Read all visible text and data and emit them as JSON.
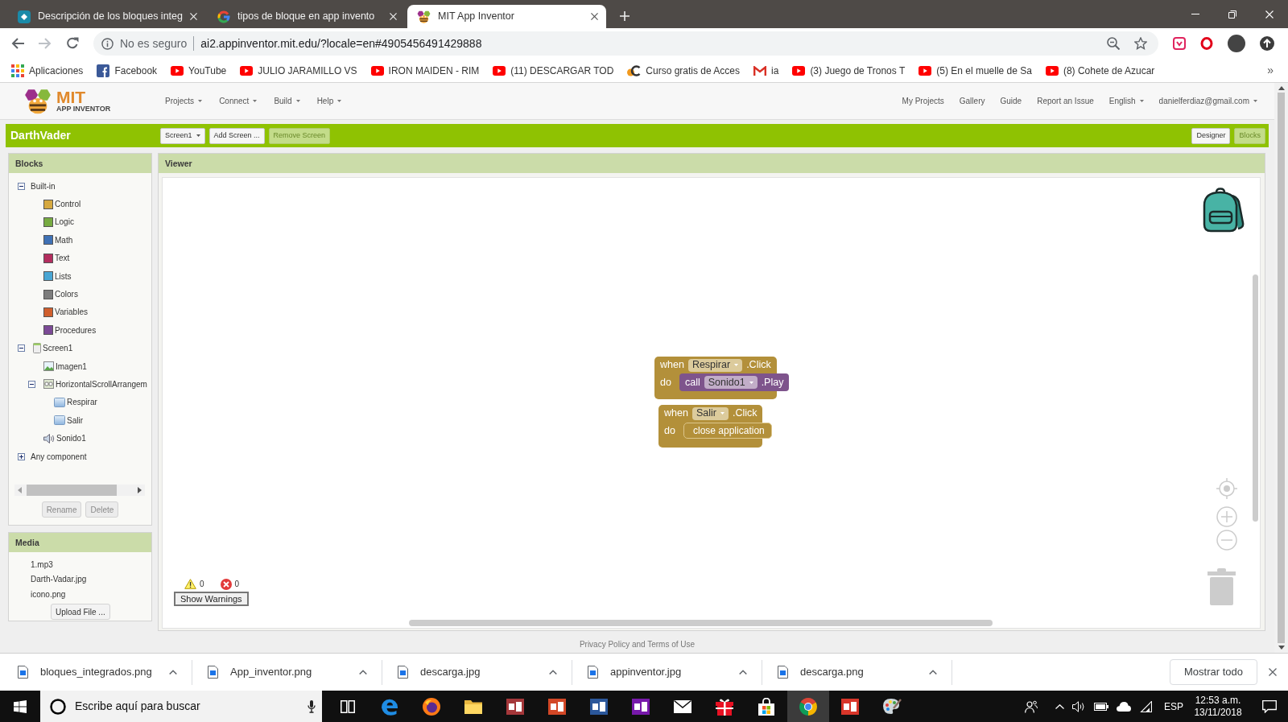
{
  "browser": {
    "tabs": [
      {
        "kind": "docs",
        "title": "Descripción de los bloques integ",
        "selected": false
      },
      {
        "kind": "search",
        "title": "tipos de bloque en app invento",
        "selected": false
      },
      {
        "kind": "app",
        "title": "MIT App Inventor",
        "selected": true
      }
    ],
    "address": {
      "security": "No es seguro",
      "url": "ai2.appinventor.mit.edu/?locale=en#4905456491429888"
    },
    "bookmarks": [
      {
        "kind": "apps",
        "label": "Aplicaciones"
      },
      {
        "kind": "social",
        "label": "Facebook"
      },
      {
        "kind": "video",
        "label": "YouTube"
      },
      {
        "kind": "video",
        "label": "JULIO JARAMILLO VS"
      },
      {
        "kind": "video",
        "label": "IRON MAIDEN - RIM"
      },
      {
        "kind": "video",
        "label": "(11) DESCARGAR TOD"
      },
      {
        "kind": "course",
        "label": "Curso gratis de Acces"
      },
      {
        "kind": "mail",
        "label": "ia"
      },
      {
        "kind": "video",
        "label": "(3) Juego de Tronos T"
      },
      {
        "kind": "video",
        "label": "(5) En el muelle de Sa"
      },
      {
        "kind": "video",
        "label": "(8) Cohete de Azucar"
      }
    ],
    "bookmarks_more": "»"
  },
  "app": {
    "logo": {
      "title": "MIT",
      "subtitle": "APP INVENTOR"
    },
    "menus": [
      {
        "label": "Projects",
        "dropdown": true
      },
      {
        "label": "Connect",
        "dropdown": true
      },
      {
        "label": "Build",
        "dropdown": true
      },
      {
        "label": "Help",
        "dropdown": true
      }
    ],
    "links": [
      {
        "label": "My Projects",
        "dropdown": false
      },
      {
        "label": "Gallery",
        "dropdown": false
      },
      {
        "label": "Guide",
        "dropdown": false
      },
      {
        "label": "Report an Issue",
        "dropdown": false
      },
      {
        "label": "English",
        "dropdown": true
      },
      {
        "label": "danielferdiaz@gmail.com",
        "dropdown": true
      }
    ]
  },
  "project": {
    "name": "DarthVader",
    "screen_menu": "Screen1",
    "buttons": [
      {
        "label": "Add Screen ...",
        "disabled": false
      },
      {
        "label": "Remove Screen",
        "disabled": true
      }
    ],
    "views": [
      {
        "label": "Designer",
        "selected": false
      },
      {
        "label": "Blocks",
        "selected": true
      }
    ]
  },
  "blocks_panel": {
    "title": "Blocks",
    "tree": [
      {
        "kind": "group",
        "label": "Built-in",
        "expanded": true,
        "children": [
          {
            "kind": "category",
            "label": "Control",
            "color": "#d6a940"
          },
          {
            "kind": "category",
            "label": "Logic",
            "color": "#77ab41"
          },
          {
            "kind": "category",
            "label": "Math",
            "color": "#3f71b5"
          },
          {
            "kind": "category",
            "label": "Text",
            "color": "#b32d5e"
          },
          {
            "kind": "category",
            "label": "Lists",
            "color": "#49a6d4"
          },
          {
            "kind": "category",
            "label": "Colors",
            "color": "#7d7d7d"
          },
          {
            "kind": "category",
            "label": "Variables",
            "color": "#d05f2d"
          },
          {
            "kind": "category",
            "label": "Procedures",
            "color": "#7c4a96"
          }
        ]
      },
      {
        "kind": "screen",
        "label": "Screen1",
        "expanded": true,
        "children": [
          {
            "kind": "image",
            "label": "Imagen1"
          },
          {
            "kind": "arrangement",
            "label": "HorizontalScrollArrangem",
            "expanded": true,
            "children": [
              {
                "kind": "button",
                "label": "Respirar"
              },
              {
                "kind": "button",
                "label": "Salir"
              }
            ]
          },
          {
            "kind": "sound",
            "label": "Sonido1"
          }
        ]
      },
      {
        "kind": "group",
        "label": "Any component",
        "expanded": false
      }
    ],
    "buttons": [
      {
        "label": "Rename",
        "disabled": true
      },
      {
        "label": "Delete",
        "disabled": true
      }
    ]
  },
  "media_panel": {
    "title": "Media",
    "files": [
      "1.mp3",
      "Darth-Vadar.jpg",
      "icono.png"
    ],
    "upload_button": "Upload File ..."
  },
  "viewer": {
    "title": "Viewer",
    "blocks": [
      {
        "kind": "event",
        "keyword": "when",
        "component": "Respirar",
        "event": ".Click",
        "do_label": "do",
        "body": [
          {
            "kind": "call",
            "keyword": "call",
            "component": "Sonido1",
            "method": ".Play"
          }
        ]
      },
      {
        "kind": "event",
        "keyword": "when",
        "component": "Salir",
        "event": ".Click",
        "do_label": "do",
        "body": [
          {
            "kind": "statement",
            "label": "close application"
          }
        ]
      }
    ],
    "warnings": {
      "warning_count": "0",
      "error_count": "0",
      "button": "Show Warnings"
    }
  },
  "footer": "Privacy Policy and Terms of Use",
  "downloads": {
    "files": [
      "bloques_integrados.png",
      "App_inventor.png",
      "descarga.jpg",
      "appinventor.jpg",
      "descarga.png"
    ],
    "show_all": "Mostrar todo"
  },
  "taskbar": {
    "search": {
      "placeholder": "Escribe aquí para buscar"
    },
    "apps": [
      {
        "kind": "taskview",
        "selected": false
      },
      {
        "kind": "swirl",
        "selected": false
      },
      {
        "kind": "foxglobe",
        "selected": false
      },
      {
        "kind": "folder",
        "selected": false
      },
      {
        "kind": "tile",
        "color": "#a4373a",
        "selected": false
      },
      {
        "kind": "tile",
        "color": "#d24726",
        "selected": false
      },
      {
        "kind": "tile",
        "color": "#2b579a",
        "selected": false
      },
      {
        "kind": "tile",
        "color": "#7719aa",
        "selected": false
      },
      {
        "kind": "envelope",
        "selected": false
      },
      {
        "kind": "gift",
        "selected": false
      },
      {
        "kind": "bag",
        "selected": false
      },
      {
        "kind": "wheel",
        "selected": true
      },
      {
        "kind": "tile",
        "color": "#d8362a",
        "selected": false
      },
      {
        "kind": "palette",
        "selected": false
      }
    ],
    "language": "ESP",
    "time": "12:53 a.m.",
    "date": "13/11/2018"
  }
}
